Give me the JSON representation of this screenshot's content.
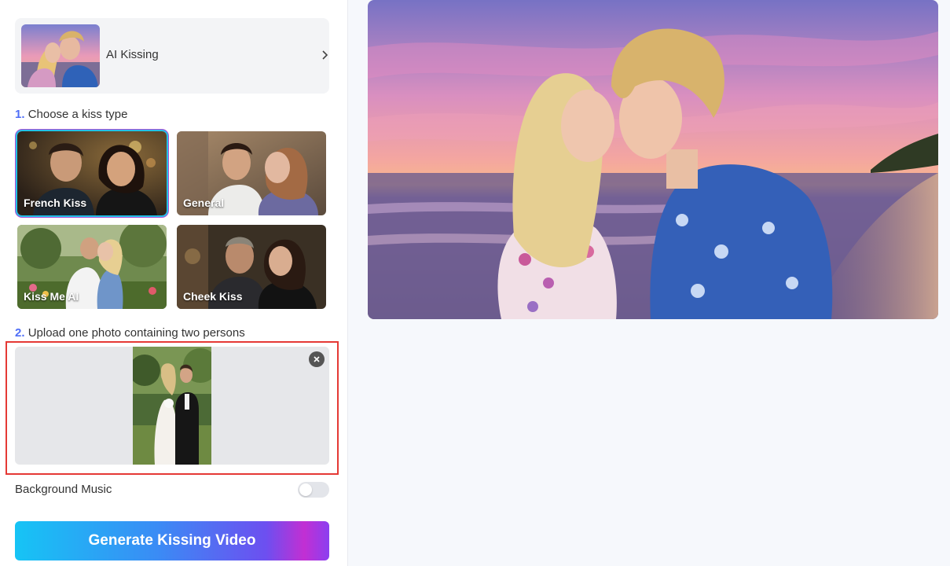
{
  "tool": {
    "title": "AI Kissing"
  },
  "step1": {
    "number": "1.",
    "label": "Choose a kiss type"
  },
  "kiss_types": [
    {
      "label": "French Kiss",
      "selected": true
    },
    {
      "label": "General",
      "selected": false
    },
    {
      "label": "Kiss Me AI",
      "selected": false
    },
    {
      "label": "Cheek Kiss",
      "selected": false
    }
  ],
  "step2": {
    "number": "2.",
    "label": "Upload one photo containing two persons"
  },
  "music": {
    "label": "Background Music",
    "enabled": false
  },
  "generate": {
    "label": "Generate Kissing Video"
  },
  "colors": {
    "accent": "#4f6ef7",
    "selected_outline": "#b04fd6",
    "upload_highlight": "#e53935"
  }
}
